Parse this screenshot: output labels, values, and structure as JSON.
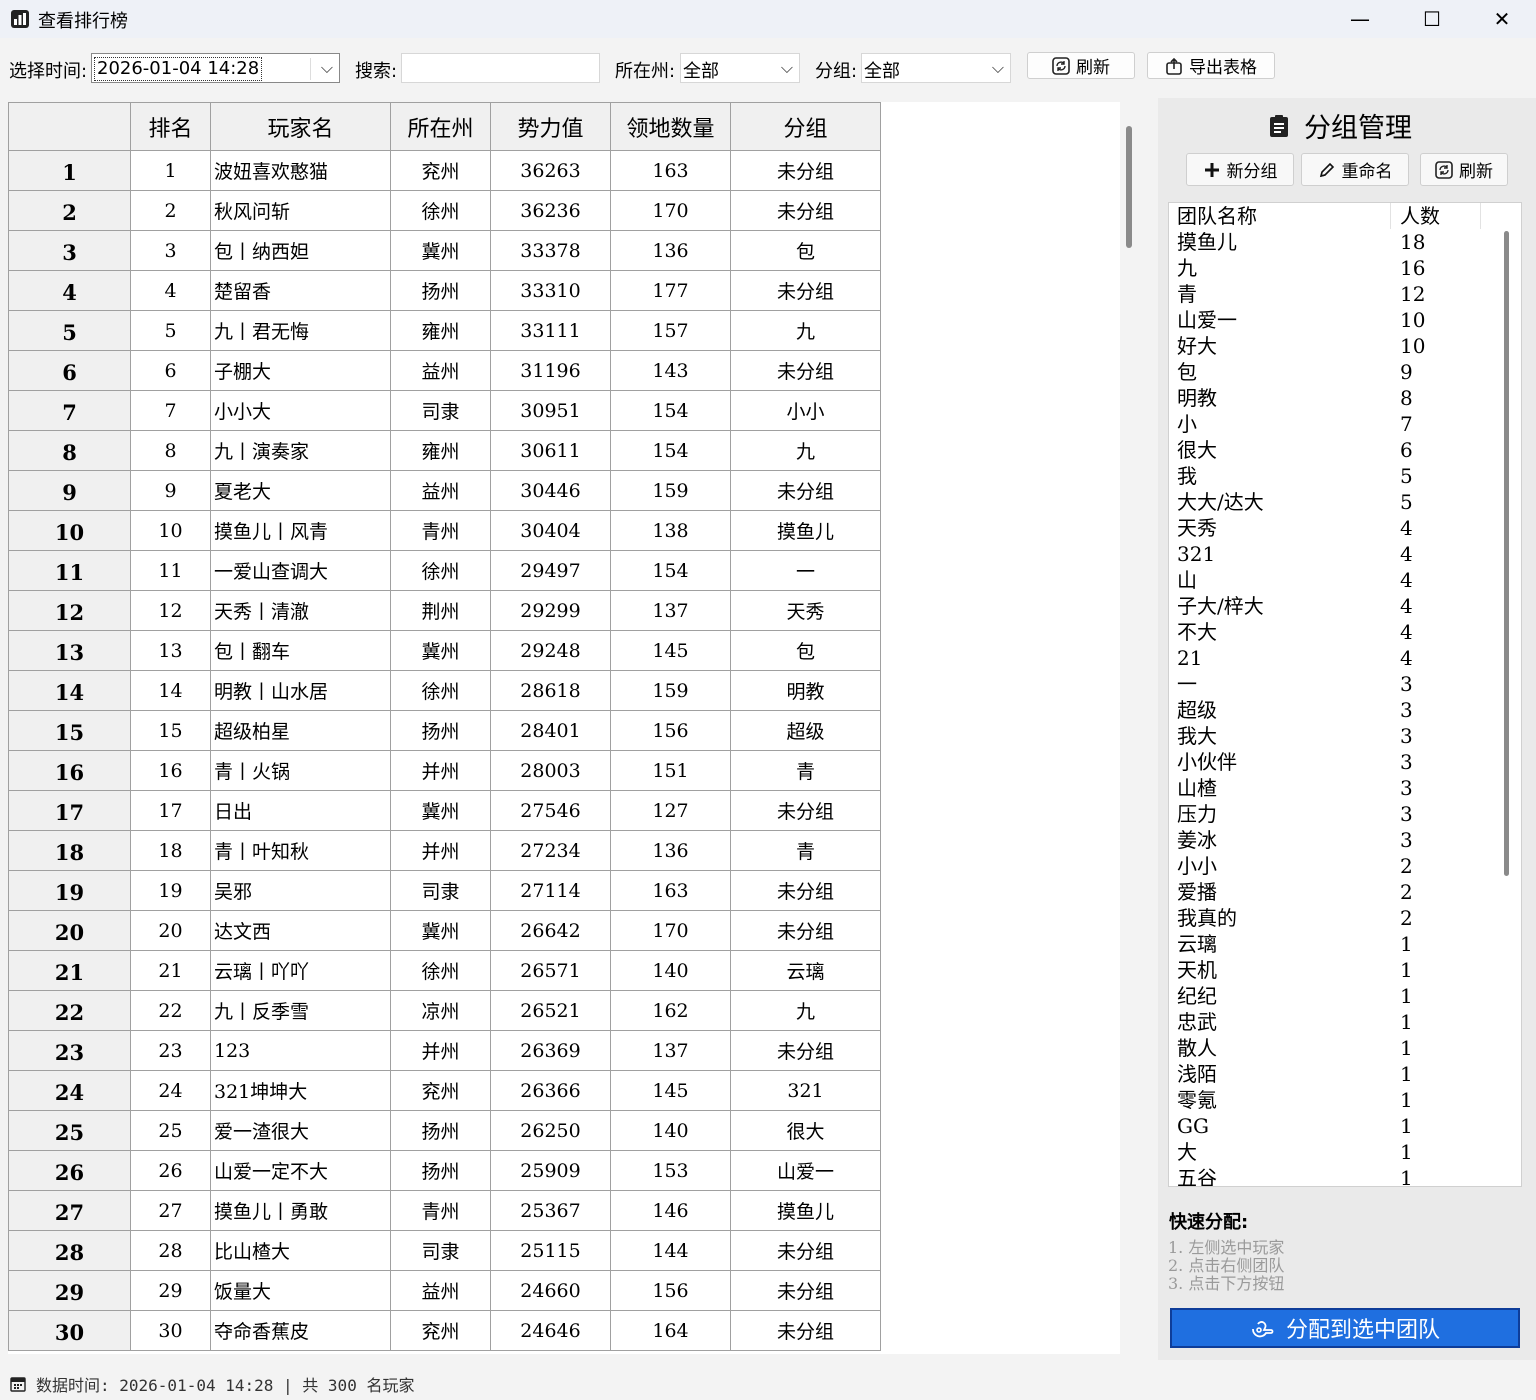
{
  "window": {
    "title": "查看排行榜",
    "min_glyph": "—",
    "max_glyph": "☐",
    "close_glyph": "✕"
  },
  "toolbar": {
    "time_label": "选择时间:",
    "time_value": "2026-01-04 14:28",
    "search_label": "搜索:",
    "search_value": "",
    "state_label": "所在州:",
    "state_value": "全部",
    "group_label": "分组:",
    "group_value": "全部",
    "refresh_label": "刷新",
    "export_label": "导出表格"
  },
  "table": {
    "headers": [
      "排名",
      "玩家名",
      "所在州",
      "势力值",
      "领地数量",
      "分组"
    ],
    "rows": [
      {
        "n": "1",
        "rank": "1",
        "name": "波妞喜欢憨猫",
        "state": "兖州",
        "power": "36263",
        "land": "163",
        "group": "未分组"
      },
      {
        "n": "2",
        "rank": "2",
        "name": "秋风问斩",
        "state": "徐州",
        "power": "36236",
        "land": "170",
        "group": "未分组"
      },
      {
        "n": "3",
        "rank": "3",
        "name": "包丨纳西妲",
        "state": "冀州",
        "power": "33378",
        "land": "136",
        "group": "包"
      },
      {
        "n": "4",
        "rank": "4",
        "name": "楚留香",
        "state": "扬州",
        "power": "33310",
        "land": "177",
        "group": "未分组"
      },
      {
        "n": "5",
        "rank": "5",
        "name": "九丨君无悔",
        "state": "雍州",
        "power": "33111",
        "land": "157",
        "group": "九"
      },
      {
        "n": "6",
        "rank": "6",
        "name": "子棚大",
        "state": "益州",
        "power": "31196",
        "land": "143",
        "group": "未分组"
      },
      {
        "n": "7",
        "rank": "7",
        "name": "小小大",
        "state": "司隶",
        "power": "30951",
        "land": "154",
        "group": "小小"
      },
      {
        "n": "8",
        "rank": "8",
        "name": "九丨演奏家",
        "state": "雍州",
        "power": "30611",
        "land": "154",
        "group": "九"
      },
      {
        "n": "9",
        "rank": "9",
        "name": "夏老大",
        "state": "益州",
        "power": "30446",
        "land": "159",
        "group": "未分组"
      },
      {
        "n": "10",
        "rank": "10",
        "name": "摸鱼儿丨风青",
        "state": "青州",
        "power": "30404",
        "land": "138",
        "group": "摸鱼儿"
      },
      {
        "n": "11",
        "rank": "11",
        "name": "一爱山查调大",
        "state": "徐州",
        "power": "29497",
        "land": "154",
        "group": "一"
      },
      {
        "n": "12",
        "rank": "12",
        "name": "天秀丨清澈",
        "state": "荆州",
        "power": "29299",
        "land": "137",
        "group": "天秀"
      },
      {
        "n": "13",
        "rank": "13",
        "name": "包丨翻车",
        "state": "冀州",
        "power": "29248",
        "land": "145",
        "group": "包"
      },
      {
        "n": "14",
        "rank": "14",
        "name": "明教丨山水居",
        "state": "徐州",
        "power": "28618",
        "land": "159",
        "group": "明教"
      },
      {
        "n": "15",
        "rank": "15",
        "name": "超级柏星",
        "state": "扬州",
        "power": "28401",
        "land": "156",
        "group": "超级"
      },
      {
        "n": "16",
        "rank": "16",
        "name": "青丨火锅",
        "state": "并州",
        "power": "28003",
        "land": "151",
        "group": "青"
      },
      {
        "n": "17",
        "rank": "17",
        "name": "日出",
        "state": "冀州",
        "power": "27546",
        "land": "127",
        "group": "未分组"
      },
      {
        "n": "18",
        "rank": "18",
        "name": "青丨叶知秋",
        "state": "并州",
        "power": "27234",
        "land": "136",
        "group": "青"
      },
      {
        "n": "19",
        "rank": "19",
        "name": "吴邪",
        "state": "司隶",
        "power": "27114",
        "land": "163",
        "group": "未分组"
      },
      {
        "n": "20",
        "rank": "20",
        "name": "达文西",
        "state": "冀州",
        "power": "26642",
        "land": "170",
        "group": "未分组"
      },
      {
        "n": "21",
        "rank": "21",
        "name": "云璃丨吖吖",
        "state": "徐州",
        "power": "26571",
        "land": "140",
        "group": "云璃"
      },
      {
        "n": "22",
        "rank": "22",
        "name": "九丨反季雪",
        "state": "凉州",
        "power": "26521",
        "land": "162",
        "group": "九"
      },
      {
        "n": "23",
        "rank": "23",
        "name": "123",
        "state": "并州",
        "power": "26369",
        "land": "137",
        "group": "未分组"
      },
      {
        "n": "24",
        "rank": "24",
        "name": "321坤坤大",
        "state": "兖州",
        "power": "26366",
        "land": "145",
        "group": "321"
      },
      {
        "n": "25",
        "rank": "25",
        "name": "爱一渣很大",
        "state": "扬州",
        "power": "26250",
        "land": "140",
        "group": "很大"
      },
      {
        "n": "26",
        "rank": "26",
        "name": "山爱一定不大",
        "state": "扬州",
        "power": "25909",
        "land": "153",
        "group": "山爱一"
      },
      {
        "n": "27",
        "rank": "27",
        "name": "摸鱼儿丨勇敢",
        "state": "青州",
        "power": "25367",
        "land": "146",
        "group": "摸鱼儿"
      },
      {
        "n": "28",
        "rank": "28",
        "name": "比山楂大",
        "state": "司隶",
        "power": "25115",
        "land": "144",
        "group": "未分组"
      },
      {
        "n": "29",
        "rank": "29",
        "name": "饭量大",
        "state": "益州",
        "power": "24660",
        "land": "156",
        "group": "未分组"
      },
      {
        "n": "30",
        "rank": "30",
        "name": "夺命香蕉皮",
        "state": "兖州",
        "power": "24646",
        "land": "164",
        "group": "未分组"
      }
    ]
  },
  "side": {
    "title": "分组管理",
    "new_label": "新分组",
    "rename_label": "重命名",
    "refresh_label": "刷新",
    "col_name": "团队名称",
    "col_count": "人数",
    "teams": [
      {
        "name": "摸鱼儿",
        "count": "18"
      },
      {
        "name": "九",
        "count": "16"
      },
      {
        "name": "青",
        "count": "12"
      },
      {
        "name": "山爱一",
        "count": "10"
      },
      {
        "name": "好大",
        "count": "10"
      },
      {
        "name": "包",
        "count": "9"
      },
      {
        "name": "明教",
        "count": "8"
      },
      {
        "name": "小",
        "count": "7"
      },
      {
        "name": "很大",
        "count": "6"
      },
      {
        "name": "我",
        "count": "5"
      },
      {
        "name": "大大/达大",
        "count": "5"
      },
      {
        "name": "天秀",
        "count": "4"
      },
      {
        "name": "321",
        "count": "4"
      },
      {
        "name": "山",
        "count": "4"
      },
      {
        "name": "子大/梓大",
        "count": "4"
      },
      {
        "name": "不大",
        "count": "4"
      },
      {
        "name": "21",
        "count": "4"
      },
      {
        "name": "一",
        "count": "3"
      },
      {
        "name": "超级",
        "count": "3"
      },
      {
        "name": "我大",
        "count": "3"
      },
      {
        "name": "小伙伴",
        "count": "3"
      },
      {
        "name": "山楂",
        "count": "3"
      },
      {
        "name": "压力",
        "count": "3"
      },
      {
        "name": "姜冰",
        "count": "3"
      },
      {
        "name": "小小",
        "count": "2"
      },
      {
        "name": "爱播",
        "count": "2"
      },
      {
        "name": "我真的",
        "count": "2"
      },
      {
        "name": "云璃",
        "count": "1"
      },
      {
        "name": "天机",
        "count": "1"
      },
      {
        "name": "纪纪",
        "count": "1"
      },
      {
        "name": "忠武",
        "count": "1"
      },
      {
        "name": "散人",
        "count": "1"
      },
      {
        "name": "浅陌",
        "count": "1"
      },
      {
        "name": "零氪",
        "count": "1"
      },
      {
        "name": "GG",
        "count": "1"
      },
      {
        "name": "大",
        "count": "1"
      },
      {
        "name": "五谷",
        "count": "1"
      }
    ],
    "quick_label": "快速分配:",
    "steps": [
      "1.  左侧选中玩家",
      "2.  点击右侧团队",
      "3.  点击下方按钮"
    ],
    "assign_label": "分配到选中团队"
  },
  "status": {
    "text": "数据时间: 2026-01-04 14:28 | 共 300 名玩家"
  },
  "colors": {
    "accent": "#1f6fe0",
    "header_bg": "#f0f0f0",
    "grid": "#a0a0a0"
  }
}
